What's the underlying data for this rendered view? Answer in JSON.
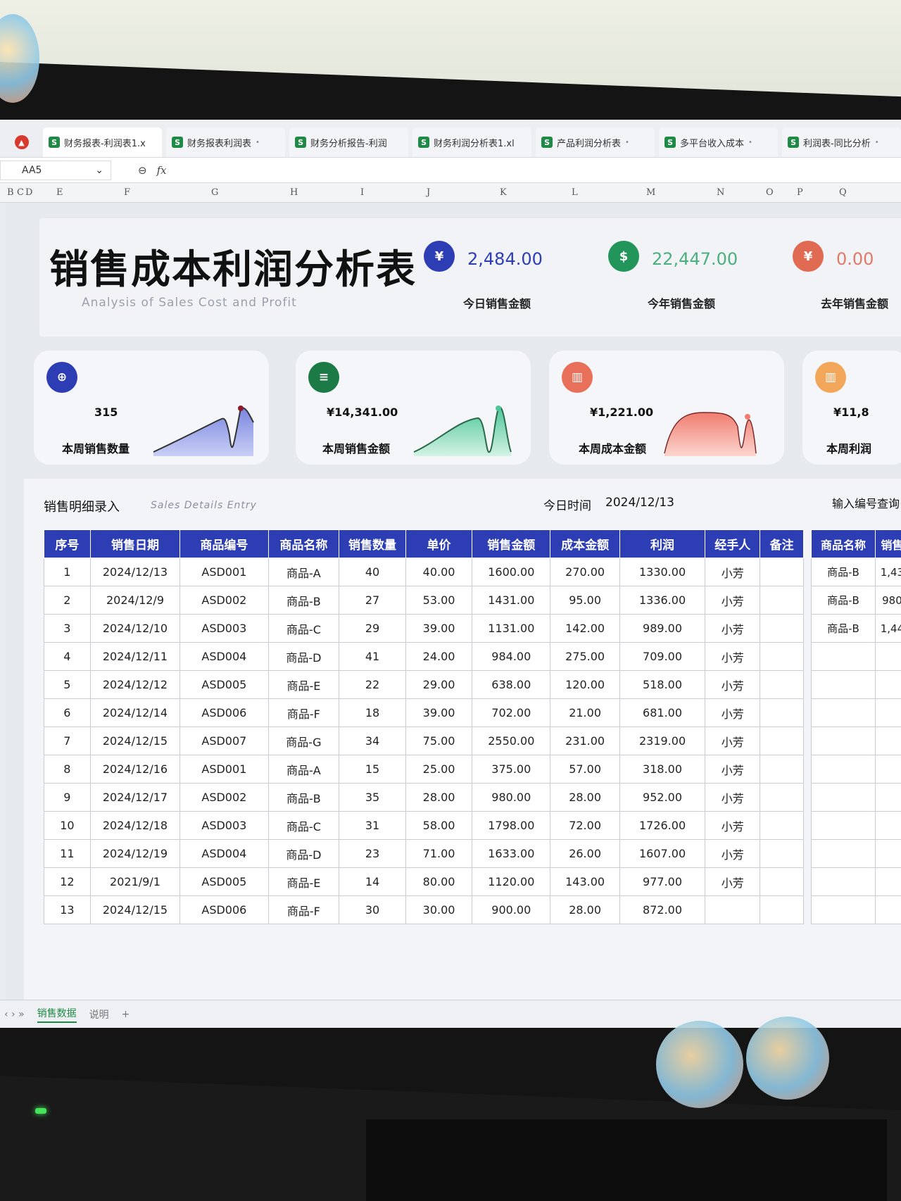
{
  "tabs": [
    {
      "label": "财务报表-利润表1.x",
      "dot": ""
    },
    {
      "label": "财务报表利润表",
      "dot": "•"
    },
    {
      "label": "财务分析报告-利润",
      "dot": ""
    },
    {
      "label": "财务利润分析表1.xl",
      "dot": ""
    },
    {
      "label": "产品利润分析表",
      "dot": "•"
    },
    {
      "label": "多平台收入成本",
      "dot": "•"
    },
    {
      "label": "利润表-同比分析",
      "dot": "•"
    }
  ],
  "formula_bar": {
    "cell_ref": "AA5",
    "zoom_glyph": "⊖",
    "fx": "fx"
  },
  "columns": [
    "B",
    "C",
    "D",
    "E",
    "F",
    "G",
    "H",
    "I",
    "J",
    "K",
    "L",
    "M",
    "N",
    "O",
    "P",
    "Q"
  ],
  "header": {
    "title": "销售成本利润分析表",
    "subtitle": "Analysis of Sales Cost and Profit",
    "kpis": [
      {
        "icon_text": "¥",
        "value": "2,484.00",
        "label": "今日销售金额",
        "color": "#2d3db4",
        "value_color": "#2d3db4"
      },
      {
        "icon_text": "$",
        "value": "22,447.00",
        "label": "今年销售金额",
        "color": "#22955a",
        "value_color": "#4caf7d"
      },
      {
        "icon_text": "¥",
        "value": "0.00",
        "label": "去年销售金额",
        "color": "#e06a52",
        "value_color": "#e07a68"
      }
    ]
  },
  "cards": [
    {
      "value": "315",
      "label": "本周销售数量",
      "color": "#2d3db4",
      "icon_text": "⊕"
    },
    {
      "value": "¥14,341.00",
      "label": "本周销售金额",
      "color": "#1b7a45",
      "icon_text": "≡"
    },
    {
      "value": "¥1,221.00",
      "label": "本周成本金额",
      "color": "#e8705a",
      "icon_text": "▥"
    },
    {
      "value": "¥11,8",
      "label": "本周利润",
      "color": "#f1a65a",
      "icon_text": "▥"
    }
  ],
  "detail": {
    "title": "销售明细录入",
    "subtitle": "Sales Details Entry",
    "time_label": "今日时间",
    "time_value": "2024/12/13",
    "query_label": "输入编号查询",
    "columns": [
      "序号",
      "销售日期",
      "商品编号",
      "商品名称",
      "销售数量",
      "单价",
      "销售金额",
      "成本金额",
      "利润",
      "经手人",
      "备注"
    ],
    "rows": [
      [
        "1",
        "2024/12/13",
        "ASD001",
        "商品-A",
        "40",
        "40.00",
        "1600.00",
        "270.00",
        "1330.00",
        "小芳",
        ""
      ],
      [
        "2",
        "2024/12/9",
        "ASD002",
        "商品-B",
        "27",
        "53.00",
        "1431.00",
        "95.00",
        "1336.00",
        "小芳",
        ""
      ],
      [
        "3",
        "2024/12/10",
        "ASD003",
        "商品-C",
        "29",
        "39.00",
        "1131.00",
        "142.00",
        "989.00",
        "小芳",
        ""
      ],
      [
        "4",
        "2024/12/11",
        "ASD004",
        "商品-D",
        "41",
        "24.00",
        "984.00",
        "275.00",
        "709.00",
        "小芳",
        ""
      ],
      [
        "5",
        "2024/12/12",
        "ASD005",
        "商品-E",
        "22",
        "29.00",
        "638.00",
        "120.00",
        "518.00",
        "小芳",
        ""
      ],
      [
        "6",
        "2024/12/14",
        "ASD006",
        "商品-F",
        "18",
        "39.00",
        "702.00",
        "21.00",
        "681.00",
        "小芳",
        ""
      ],
      [
        "7",
        "2024/12/15",
        "ASD007",
        "商品-G",
        "34",
        "75.00",
        "2550.00",
        "231.00",
        "2319.00",
        "小芳",
        ""
      ],
      [
        "8",
        "2024/12/16",
        "ASD001",
        "商品-A",
        "15",
        "25.00",
        "375.00",
        "57.00",
        "318.00",
        "小芳",
        ""
      ],
      [
        "9",
        "2024/12/17",
        "ASD002",
        "商品-B",
        "35",
        "28.00",
        "980.00",
        "28.00",
        "952.00",
        "小芳",
        ""
      ],
      [
        "10",
        "2024/12/18",
        "ASD003",
        "商品-C",
        "31",
        "58.00",
        "1798.00",
        "72.00",
        "1726.00",
        "小芳",
        ""
      ],
      [
        "11",
        "2024/12/19",
        "ASD004",
        "商品-D",
        "23",
        "71.00",
        "1633.00",
        "26.00",
        "1607.00",
        "小芳",
        ""
      ],
      [
        "12",
        "2021/9/1",
        "ASD005",
        "商品-E",
        "14",
        "80.00",
        "1120.00",
        "143.00",
        "977.00",
        "小芳",
        ""
      ],
      [
        "13",
        "2024/12/15",
        "ASD006",
        "商品-F",
        "30",
        "30.00",
        "900.00",
        "28.00",
        "872.00",
        "",
        ""
      ]
    ],
    "side_columns": [
      "商品名称",
      "销售"
    ],
    "side_rows": [
      [
        "商品-B",
        "1,43"
      ],
      [
        "商品-B",
        "980"
      ],
      [
        "商品-B",
        "1,44"
      ],
      [
        "",
        ""
      ],
      [
        "",
        ""
      ],
      [
        "",
        ""
      ],
      [
        "",
        ""
      ],
      [
        "",
        ""
      ],
      [
        "",
        ""
      ],
      [
        "",
        ""
      ],
      [
        "",
        ""
      ],
      [
        "",
        ""
      ],
      [
        "",
        ""
      ]
    ]
  },
  "sheet_tabs": {
    "nav": "‹ › »",
    "active": "销售数据",
    "other": "说明",
    "add": "+"
  }
}
